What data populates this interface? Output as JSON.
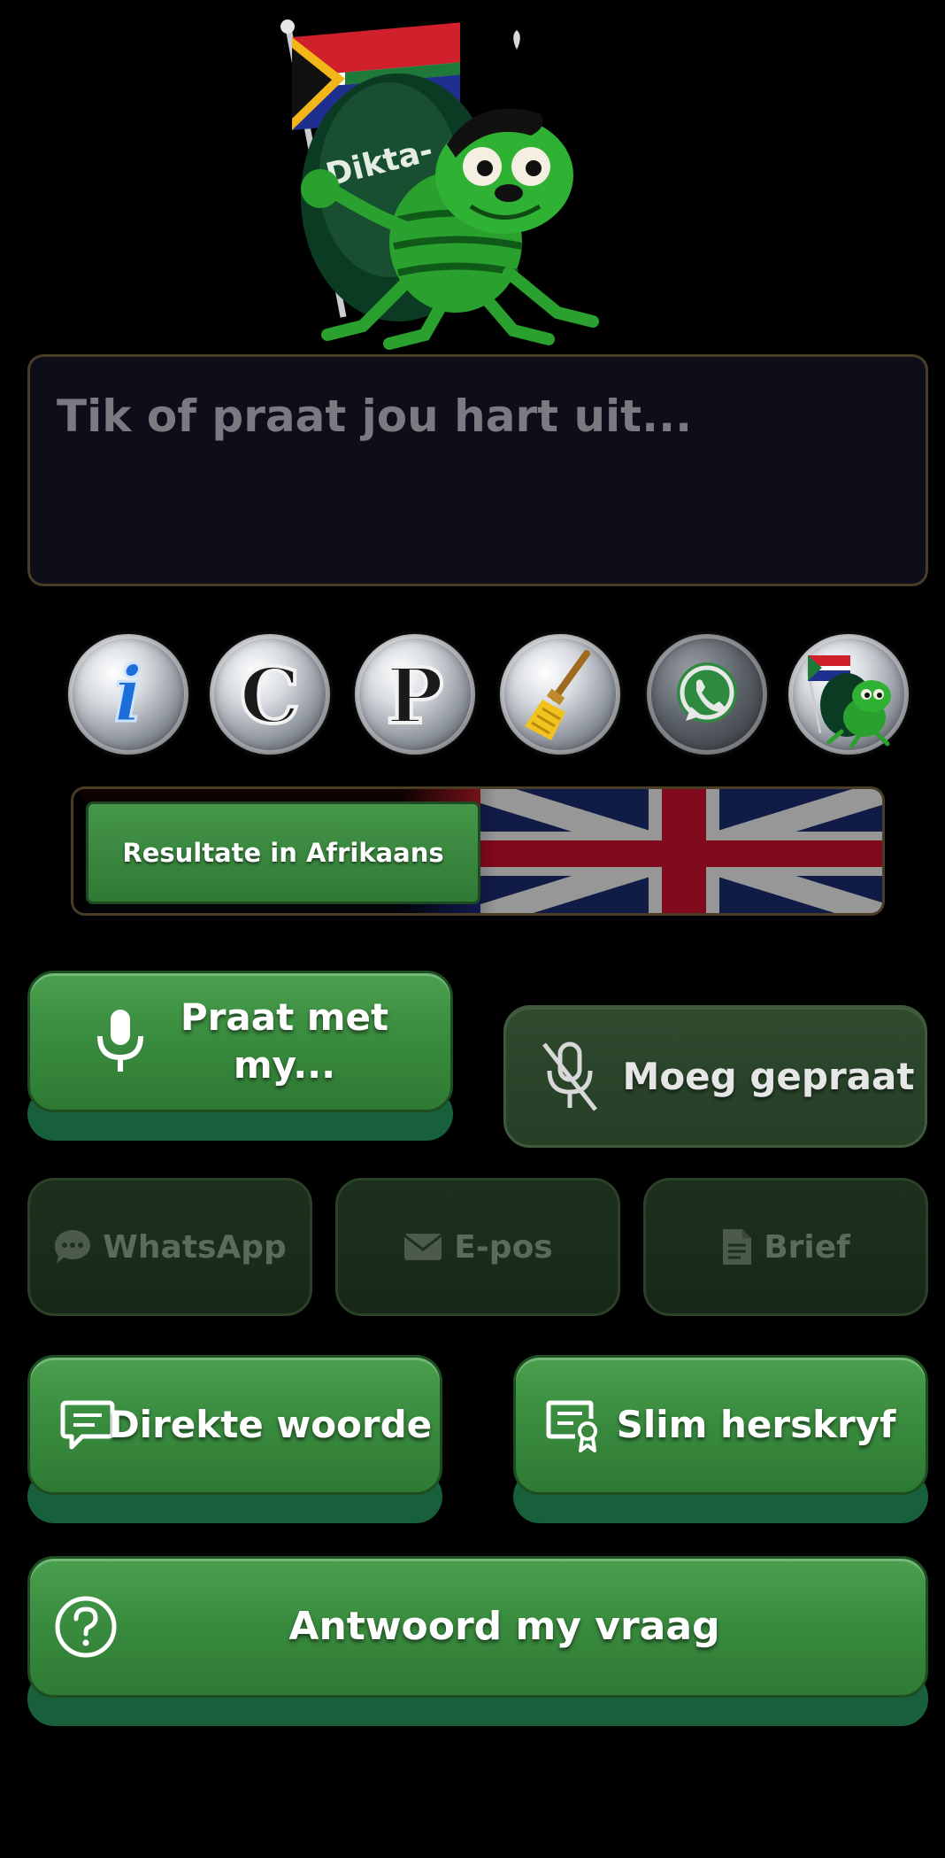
{
  "mascot": {
    "flag_text": "Dikta-"
  },
  "input": {
    "placeholder": "Tik of praat jou hart uit..."
  },
  "tools": {
    "info": "i",
    "copy": "C",
    "paste": "P"
  },
  "language_toggle": {
    "label": "Resultate in Afrikaans"
  },
  "actions": {
    "speak_label": "Praat met my...",
    "stop_label": "Moeg gepraat",
    "whatsapp_label": "WhatsApp",
    "email_label": "E-pos",
    "letter_label": "Brief",
    "direct_label": "Direkte woorde",
    "rewrite_label": "Slim herskryf",
    "answer_label": "Antwoord my vraag"
  },
  "colors": {
    "background": "#000000",
    "button_green": "#3a8c3f",
    "button_base": "#17603b",
    "disabled_green": "#1d301e",
    "border_gold": "#4a3d26"
  }
}
